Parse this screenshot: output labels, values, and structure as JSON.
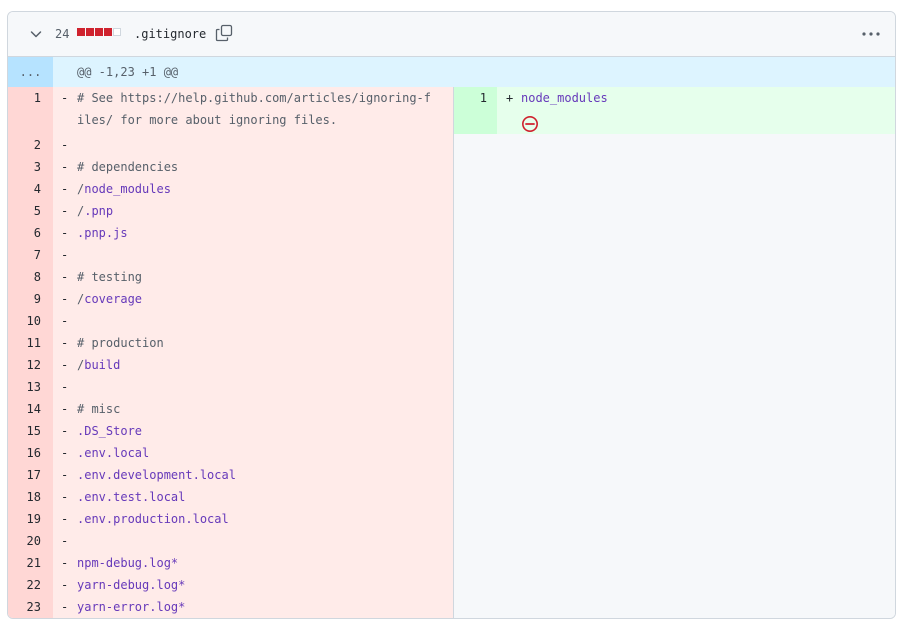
{
  "header": {
    "change_count": "24",
    "filename": ".gitignore",
    "diff_blocks": [
      "del",
      "del",
      "del",
      "del",
      "neutral"
    ],
    "colors": {
      "deletion": "#cf222e",
      "addition_bg": "#e6ffec",
      "deletion_bg": "#ffebe9"
    }
  },
  "hunk": {
    "expander": "...",
    "header": "@@ -1,23 +1 @@"
  },
  "left_lines": [
    {
      "num": "1",
      "sign": "-",
      "parts": [
        {
          "t": "# See https://help.github.com/articles/ignoring-files/ for more about ignoring files.",
          "c": "plain"
        }
      ]
    },
    {
      "num": "2",
      "sign": "-",
      "parts": []
    },
    {
      "num": "3",
      "sign": "-",
      "parts": [
        {
          "t": "# dependencies",
          "c": "plain"
        }
      ]
    },
    {
      "num": "4",
      "sign": "-",
      "parts": [
        {
          "t": "/",
          "c": "plain"
        },
        {
          "t": "node_modules",
          "c": "kw"
        }
      ]
    },
    {
      "num": "5",
      "sign": "-",
      "parts": [
        {
          "t": "/",
          "c": "plain"
        },
        {
          "t": ".pnp",
          "c": "kw"
        }
      ]
    },
    {
      "num": "6",
      "sign": "-",
      "parts": [
        {
          "t": ".pnp.js",
          "c": "kw"
        }
      ]
    },
    {
      "num": "7",
      "sign": "-",
      "parts": []
    },
    {
      "num": "8",
      "sign": "-",
      "parts": [
        {
          "t": "# testing",
          "c": "plain"
        }
      ]
    },
    {
      "num": "9",
      "sign": "-",
      "parts": [
        {
          "t": "/",
          "c": "plain"
        },
        {
          "t": "coverage",
          "c": "kw"
        }
      ]
    },
    {
      "num": "10",
      "sign": "-",
      "parts": []
    },
    {
      "num": "11",
      "sign": "-",
      "parts": [
        {
          "t": "# production",
          "c": "plain"
        }
      ]
    },
    {
      "num": "12",
      "sign": "-",
      "parts": [
        {
          "t": "/",
          "c": "plain"
        },
        {
          "t": "build",
          "c": "kw"
        }
      ]
    },
    {
      "num": "13",
      "sign": "-",
      "parts": []
    },
    {
      "num": "14",
      "sign": "-",
      "parts": [
        {
          "t": "# misc",
          "c": "plain"
        }
      ]
    },
    {
      "num": "15",
      "sign": "-",
      "parts": [
        {
          "t": ".DS_Store",
          "c": "kw"
        }
      ]
    },
    {
      "num": "16",
      "sign": "-",
      "parts": [
        {
          "t": ".env.local",
          "c": "kw"
        }
      ]
    },
    {
      "num": "17",
      "sign": "-",
      "parts": [
        {
          "t": ".env.development.local",
          "c": "kw"
        }
      ]
    },
    {
      "num": "18",
      "sign": "-",
      "parts": [
        {
          "t": ".env.test.local",
          "c": "kw"
        }
      ]
    },
    {
      "num": "19",
      "sign": "-",
      "parts": [
        {
          "t": ".env.production.local",
          "c": "kw"
        }
      ]
    },
    {
      "num": "20",
      "sign": "-",
      "parts": []
    },
    {
      "num": "21",
      "sign": "-",
      "parts": [
        {
          "t": "npm-debug.log*",
          "c": "kw"
        }
      ]
    },
    {
      "num": "22",
      "sign": "-",
      "parts": [
        {
          "t": "yarn-debug.log*",
          "c": "kw"
        }
      ]
    },
    {
      "num": "23",
      "sign": "-",
      "parts": [
        {
          "t": "yarn-error.log*",
          "c": "kw"
        }
      ]
    }
  ],
  "right_lines": [
    {
      "num": "1",
      "sign": "+",
      "text": "node_modules"
    }
  ],
  "no_newline_icon": "no-newline-icon"
}
